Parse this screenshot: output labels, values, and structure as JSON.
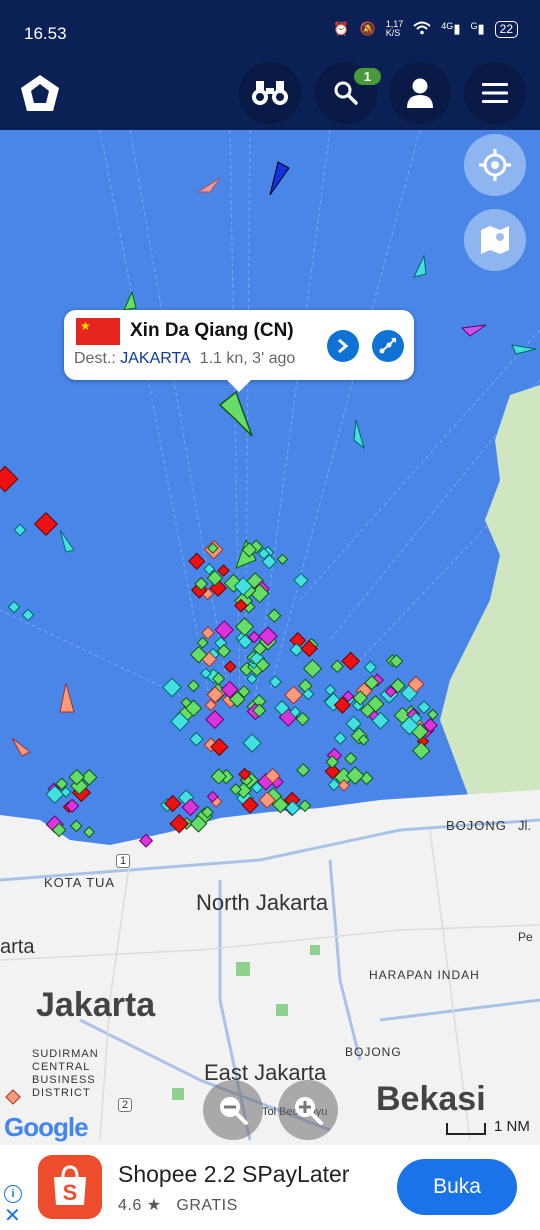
{
  "status": {
    "time": "16.53",
    "net_speed": "1,17\nK/S",
    "signal1": "4G",
    "signal2": "G",
    "battery": "22"
  },
  "toolbar": {
    "search_badge": "1",
    "icons": [
      "marinetraffic-logo-icon",
      "binoculars-icon",
      "search-icon",
      "user-icon",
      "menu-icon"
    ]
  },
  "popup": {
    "flag": "★",
    "ship_name": "Xin Da Qiang (CN)",
    "dest_label": "Dest.:",
    "destination": "JAKARTA",
    "status": "1.1 kn, 3' ago"
  },
  "map_labels": {
    "bojong": "BOJONG",
    "jl": "Jl.",
    "kota_tua": "KOTA TUA",
    "north_jakarta": "North Jakarta",
    "jakarta_partial": "arta",
    "harapan_indah": "HARAPAN INDAH",
    "jakarta": "Jakarta",
    "bojong2": "BOJONG",
    "sudirman": "SUDIRMAN\nCENTRAL\nBUSINESS\nDISTRICT",
    "east_jakarta": "East Jakarta",
    "bekasi": "Bekasi",
    "toll": "Tol Becakayu",
    "pe": "Pe",
    "road1": "1",
    "road2": "2"
  },
  "map_footer": {
    "google": "Google",
    "scale": "1 NM"
  },
  "ad": {
    "title": "Shopee 2.2 SPayLater",
    "rating": "4.6 ★",
    "price": "GRATIS",
    "button": "Buka",
    "info": "i",
    "close": "✕"
  },
  "colors": {
    "sea": "#4a86e8",
    "land": "#f2f2f2",
    "toolbar": "#0b2156",
    "ship_green": "#66dd66",
    "ship_cyan": "#44e0e0",
    "ship_red": "#ee1111",
    "ship_magenta": "#dd33dd",
    "ship_orange": "#ff9977",
    "accent": "#1a73e8"
  }
}
